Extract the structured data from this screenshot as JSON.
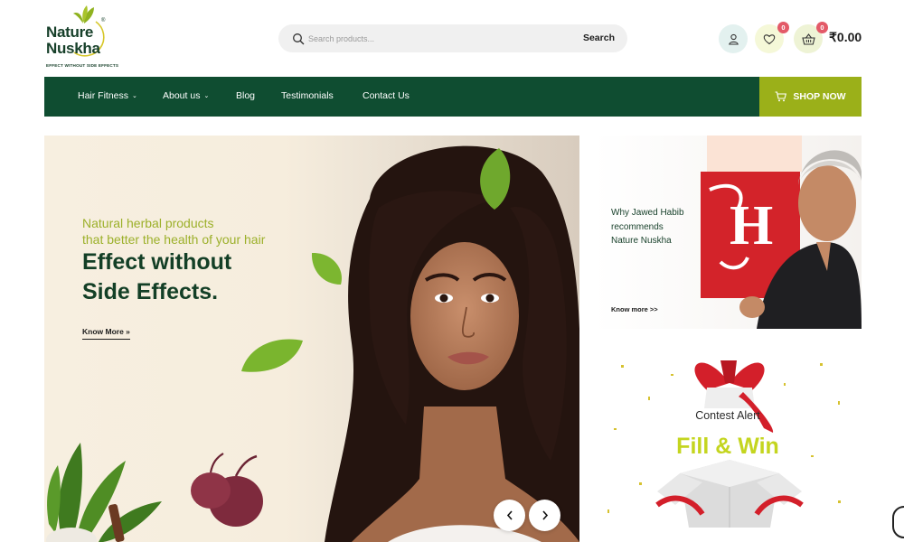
{
  "brand": {
    "name_line1": "Nature",
    "name_line2": "Nuskha",
    "registered": "®",
    "tagline": "EFFECT WITHOUT SIDE EFFECTS",
    "primary_color": "#0f4d31",
    "accent_color": "#9bb019"
  },
  "search": {
    "placeholder": "Search products...",
    "button_label": "Search"
  },
  "header_icons": {
    "user_icon": "user-icon",
    "wishlist_count": "0",
    "cart_count": "0",
    "cart_total": "₹0.00"
  },
  "nav": {
    "items": [
      {
        "label": "Hair Fitness",
        "has_dropdown": true
      },
      {
        "label": "About us",
        "has_dropdown": true
      },
      {
        "label": "Blog",
        "has_dropdown": false
      },
      {
        "label": "Testimonials",
        "has_dropdown": false
      },
      {
        "label": "Contact Us",
        "has_dropdown": false
      }
    ],
    "cta_label": "SHOP NOW"
  },
  "hero": {
    "subtitle_line1": "Natural herbal products",
    "subtitle_line2": "that better the health of your hair",
    "title_line1": "Effect without",
    "title_line2": "Side Effects.",
    "link_label": "Know More »"
  },
  "promo_habib": {
    "text_line1": "Why Jawed Habib",
    "text_line2": "recommends",
    "text_line3": "Nature Nuskha",
    "link_label": "Know more >>"
  },
  "promo_contest": {
    "label": "Contest Alert",
    "title": "Fill & Win"
  }
}
